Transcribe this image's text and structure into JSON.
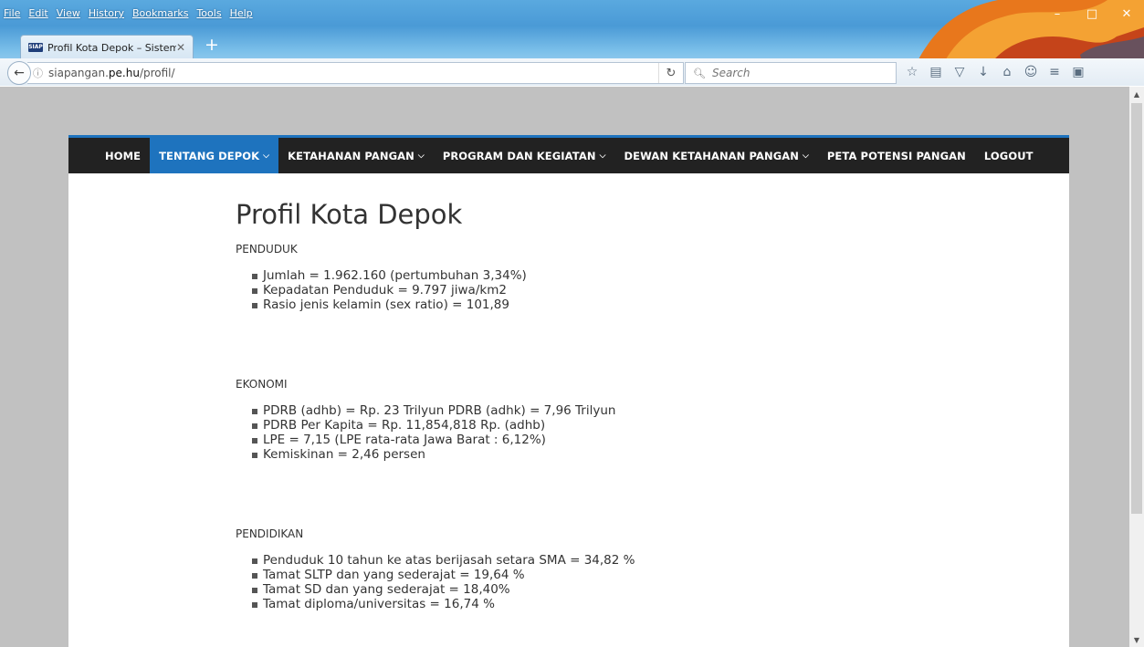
{
  "browser": {
    "menu": [
      "File",
      "Edit",
      "View",
      "History",
      "Bookmarks",
      "Tools",
      "Help"
    ],
    "tab_title": "Profil Kota Depok – Sistem...",
    "favicon_text": "SIAP",
    "url_prefix": "siapangan.",
    "url_domain": "pe.hu",
    "url_path": "/profil/",
    "search_placeholder": "Search"
  },
  "site": {
    "nav": [
      {
        "label": "HOME",
        "dropdown": false
      },
      {
        "label": "TENTANG DEPOK",
        "dropdown": true,
        "active": true
      },
      {
        "label": "KETAHANAN PANGAN",
        "dropdown": true
      },
      {
        "label": "PROGRAM DAN KEGIATAN",
        "dropdown": true
      },
      {
        "label": "DEWAN KETAHANAN PANGAN",
        "dropdown": true
      },
      {
        "label": "PETA POTENSI PANGAN",
        "dropdown": false
      },
      {
        "label": "LOGOUT",
        "dropdown": false
      }
    ]
  },
  "content": {
    "title": "Profil Kota Depok",
    "sections": [
      {
        "heading": "PENDUDUK",
        "items": [
          "Jumlah = 1.962.160 (pertumbuhan  3,34%)",
          "Kepadatan Penduduk = 9.797 jiwa/km2",
          "Rasio jenis kelamin (sex ratio) = 101,89"
        ]
      },
      {
        "heading": "EKONOMI",
        "items": [
          "PDRB (adhb) = Rp. 23 Trilyun PDRB (adhk) = 7,96 Trilyun",
          "PDRB Per Kapita = Rp. 11,854,818 Rp. (adhb)",
          "LPE = 7,15 (LPE rata-rata Jawa Barat : 6,12%)",
          "Kemiskinan = 2,46 persen"
        ]
      },
      {
        "heading": "PENDIDIKAN",
        "items": [
          "Penduduk 10 tahun ke atas berijasah setara SMA = 34,82 %",
          "Tamat SLTP dan yang sederajat = 19,64 %",
          "Tamat SD dan yang sederajat = 18,40%",
          "Tamat diploma/universitas = 16,74 %"
        ]
      }
    ]
  }
}
